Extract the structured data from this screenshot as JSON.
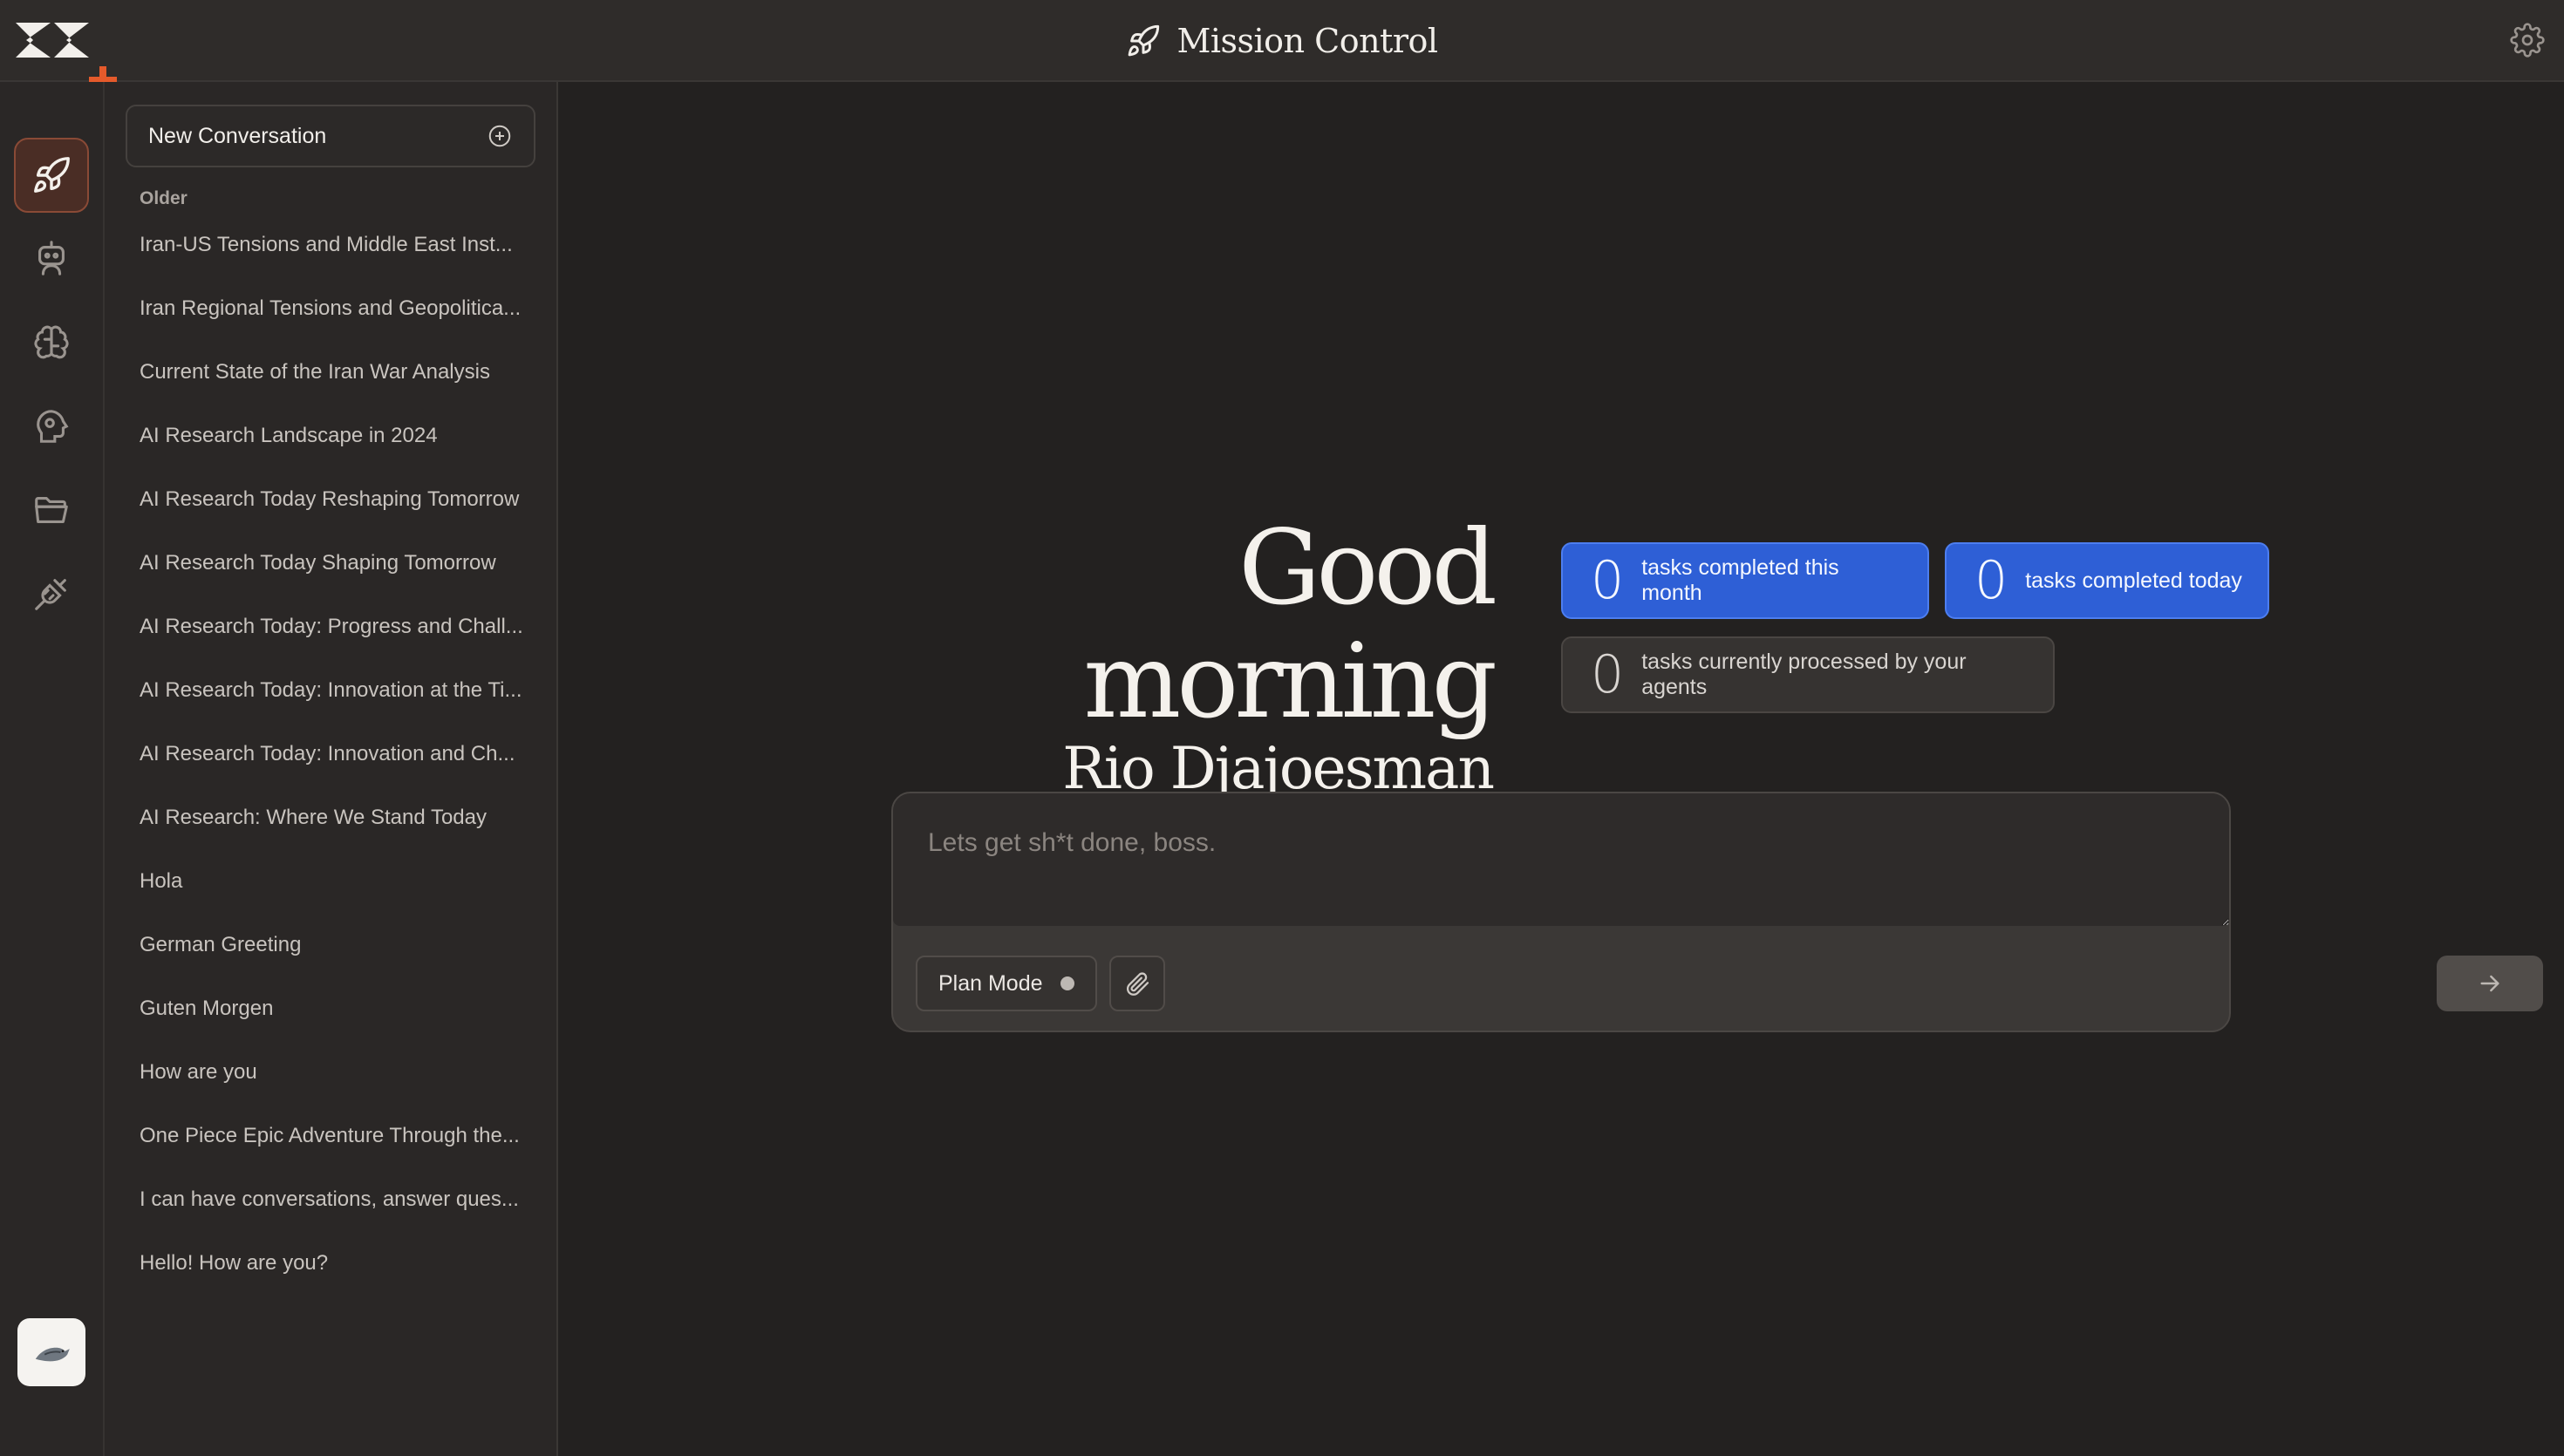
{
  "header": {
    "title": "Mission Control",
    "accent_color": "#e55a2b"
  },
  "rail": {
    "items": [
      {
        "icon": "rocket-icon",
        "active": true
      },
      {
        "icon": "robot-icon",
        "active": false
      },
      {
        "icon": "brain-icon",
        "active": false
      },
      {
        "icon": "head-gear-icon",
        "active": false
      },
      {
        "icon": "folder-icon",
        "active": false
      },
      {
        "icon": "plug-icon",
        "active": false
      }
    ]
  },
  "sidebar": {
    "new_conversation_label": "New Conversation",
    "section_label": "Older",
    "conversations": [
      "Iran-US Tensions and Middle East Inst...",
      "Iran Regional Tensions and Geopolitica...",
      "Current State of the Iran War Analysis",
      "AI Research Landscape in 2024",
      "AI Research Today Reshaping Tomorrow",
      "AI Research Today Shaping Tomorrow",
      "AI Research Today: Progress and Chall...",
      "AI Research Today: Innovation at the Ti...",
      "AI Research Today: Innovation and Ch...",
      "AI Research: Where We Stand Today",
      "Hola",
      "German Greeting",
      "Guten Morgen",
      "How are you",
      "One Piece Epic Adventure Through the...",
      "I can have conversations, answer ques...",
      "Hello! How are you?"
    ]
  },
  "main": {
    "greeting": "Good morning",
    "user_name": "Rio Djajoesman",
    "stats": [
      {
        "value": "0",
        "label": "tasks completed this month"
      },
      {
        "value": "0",
        "label": "tasks completed today"
      },
      {
        "value": "0",
        "label": "tasks currently processed by your agents"
      }
    ],
    "composer": {
      "placeholder": "Lets get sh*t done, boss.",
      "plan_mode_label": "Plan Mode"
    }
  },
  "colors": {
    "primary_blue": "#2e5fd6",
    "active_rail": "#4a2d25"
  }
}
